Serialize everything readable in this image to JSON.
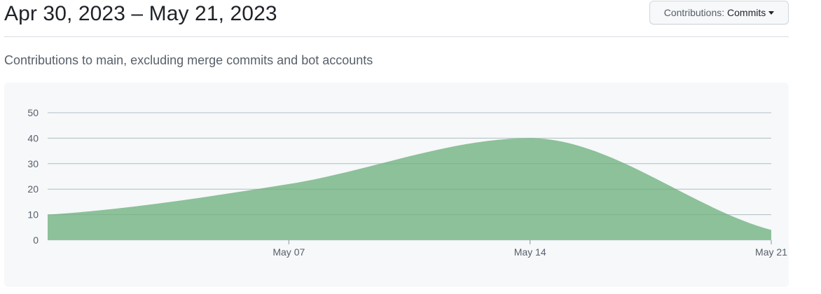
{
  "header": {
    "date_range": "Apr 30, 2023 – May 21, 2023",
    "contributions_label": "Contributions:",
    "contributions_value": "Commits"
  },
  "subtitle": "Contributions to main, excluding merge commits and bot accounts",
  "colors": {
    "area_fill": "#8cc199",
    "grid": "#d4d9e8",
    "background": "#f6f8fa"
  },
  "chart_data": {
    "type": "area",
    "title": "",
    "xlabel": "",
    "ylabel": "",
    "ylim": [
      0,
      50
    ],
    "yticks": [
      "0",
      "10",
      "20",
      "30",
      "40",
      "50"
    ],
    "xticks": [
      "May 07",
      "May 14",
      "May 21"
    ],
    "x": [
      "2023-04-30",
      "2023-05-07",
      "2023-05-14",
      "2023-05-21"
    ],
    "series": [
      {
        "values": [
          10,
          22,
          40,
          4
        ]
      }
    ],
    "grid": true,
    "legend": "none"
  }
}
